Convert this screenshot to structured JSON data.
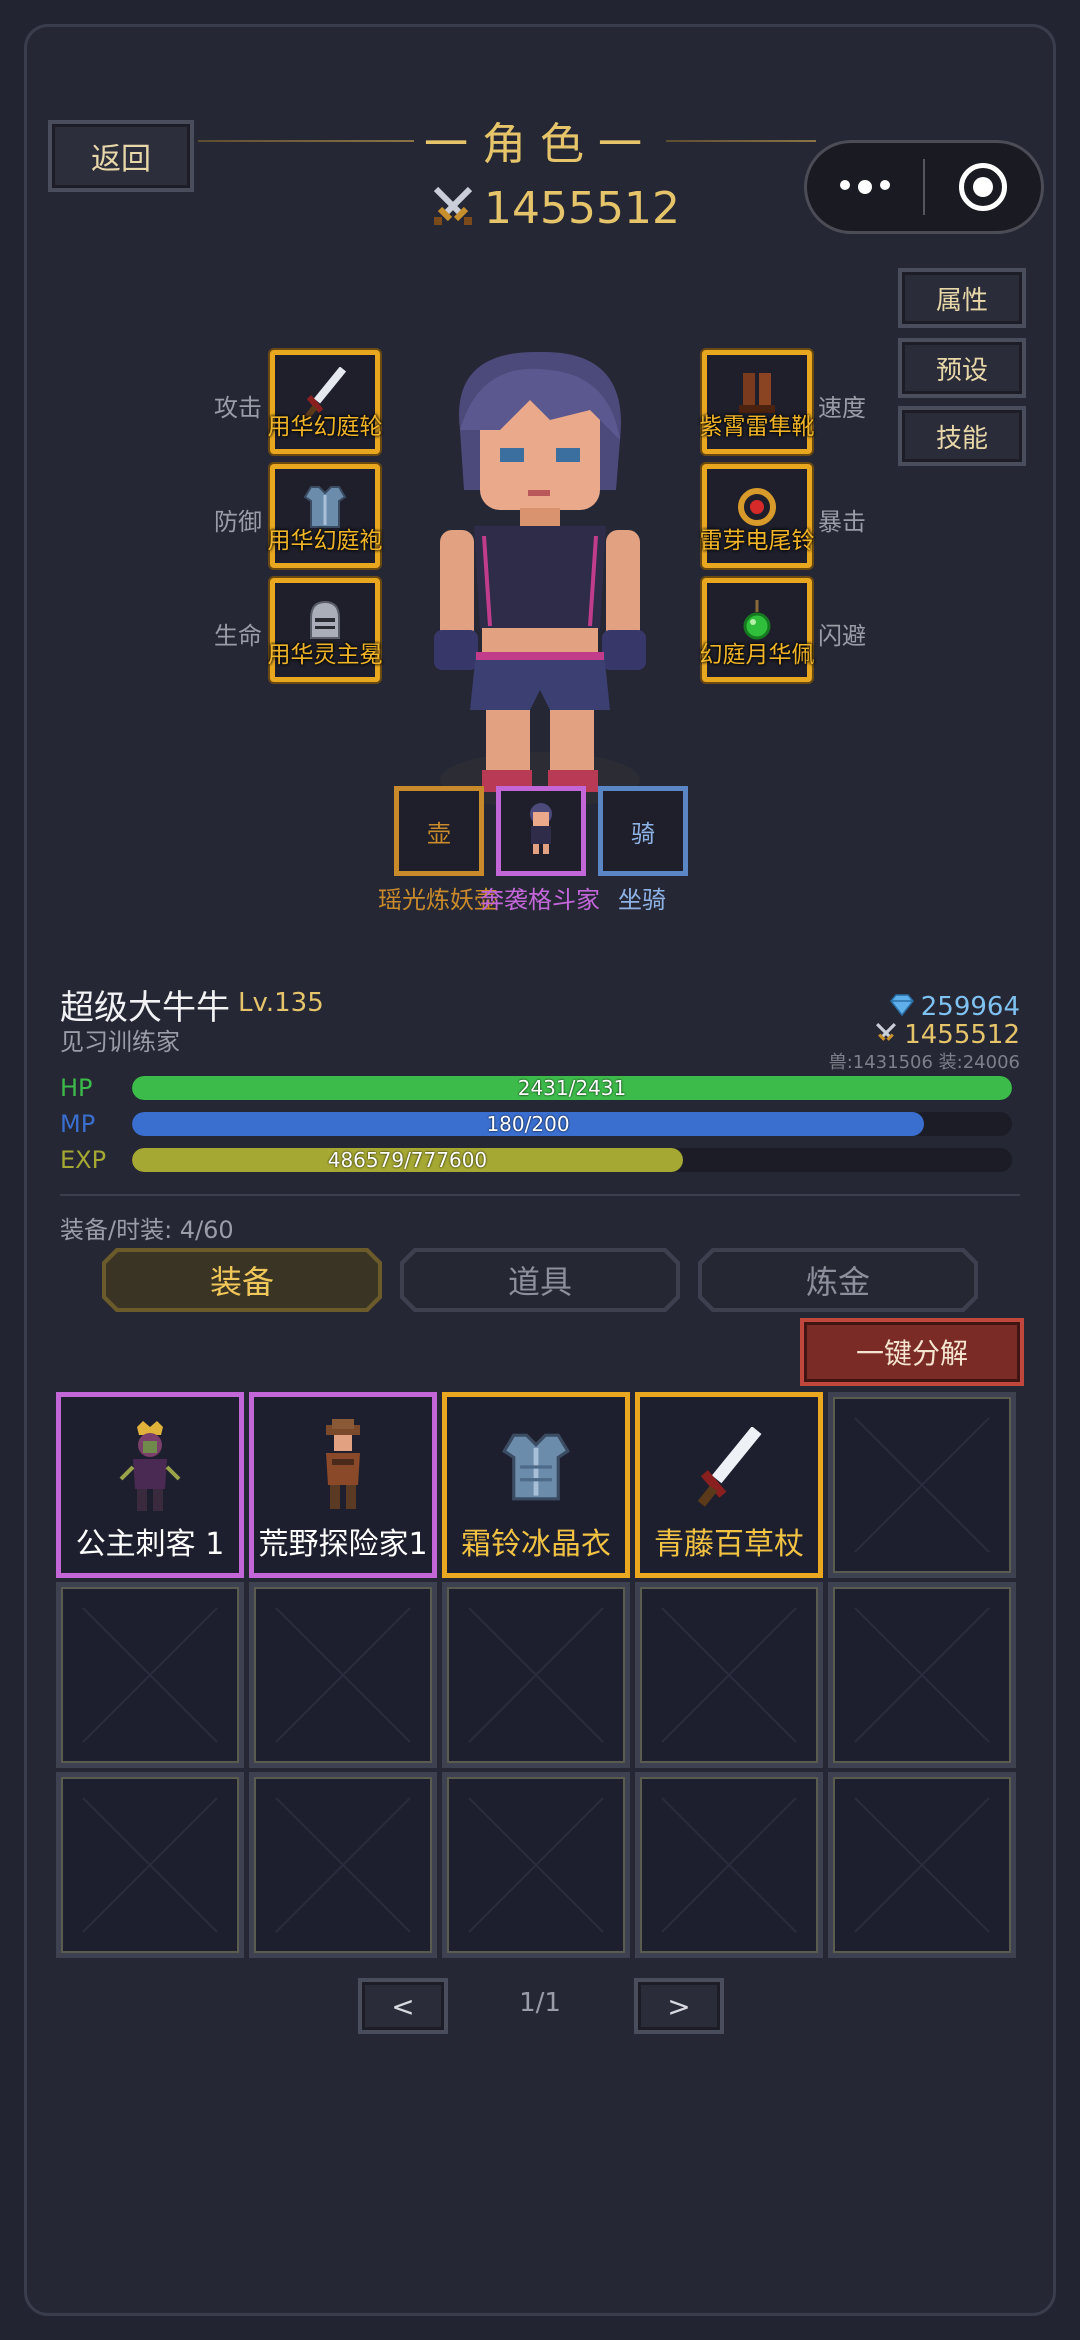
{
  "header": {
    "back_label": "返回",
    "title": "一角色一",
    "power": "1455512"
  },
  "side_buttons": [
    "属性",
    "预设",
    "技能"
  ],
  "equipment": {
    "left": [
      {
        "stat": "攻击",
        "name": "用华幻庭轮",
        "icon": "sword-icon"
      },
      {
        "stat": "防御",
        "name": "用华幻庭袍",
        "icon": "armor-icon"
      },
      {
        "stat": "生命",
        "name": "用华灵主冕",
        "icon": "helmet-icon"
      }
    ],
    "right": [
      {
        "stat": "速度",
        "name": "紫霄雷隼靴",
        "icon": "boots-icon"
      },
      {
        "stat": "暴击",
        "name": "雷芽电尾铃",
        "icon": "bell-icon"
      },
      {
        "stat": "闪避",
        "name": "幻庭月华佩",
        "icon": "pendant-icon"
      }
    ]
  },
  "mini_slots": [
    {
      "label": "瑶光炼妖壶",
      "glyph": "壶",
      "color": "#c98a2b"
    },
    {
      "label": "奔袭格斗家",
      "glyph": "",
      "color": "#c266d8"
    },
    {
      "label": "坐骑",
      "glyph": "骑",
      "color": "#5a86c6"
    }
  ],
  "player": {
    "name": "超级大牛牛",
    "level": "Lv.135",
    "title": "见习训练家",
    "diamonds": "259964",
    "power": "1455512",
    "sub_stats": "兽:1431506 装:24006"
  },
  "bars": {
    "hp": {
      "label": "HP",
      "text": "2431/2431",
      "fraction": 1.0,
      "color": "#3dbb4a"
    },
    "mp": {
      "label": "MP",
      "text": "180/200",
      "fraction": 0.9,
      "color": "#3a6fd0"
    },
    "exp": {
      "label": "EXP",
      "text": "486579/777600",
      "fraction": 0.626,
      "color": "#a5a832"
    }
  },
  "inventory": {
    "count_label": "装备/时装: 4/60",
    "tabs": [
      "装备",
      "道具",
      "炼金"
    ],
    "decompose_label": "一键分解",
    "items": [
      {
        "name": "公主刺客 1",
        "rarity": "purple",
        "icon": "assassin-icon"
      },
      {
        "name": "荒野探险家1",
        "rarity": "purple",
        "icon": "explorer-icon"
      },
      {
        "name": "霜铃冰晶衣",
        "rarity": "gold",
        "icon": "armor-icon"
      },
      {
        "name": "青藤百草杖",
        "rarity": "gold",
        "icon": "sword-icon"
      }
    ],
    "total_cells": 15
  },
  "pager": {
    "prev": "<",
    "next": ">",
    "indicator": "1/1"
  }
}
